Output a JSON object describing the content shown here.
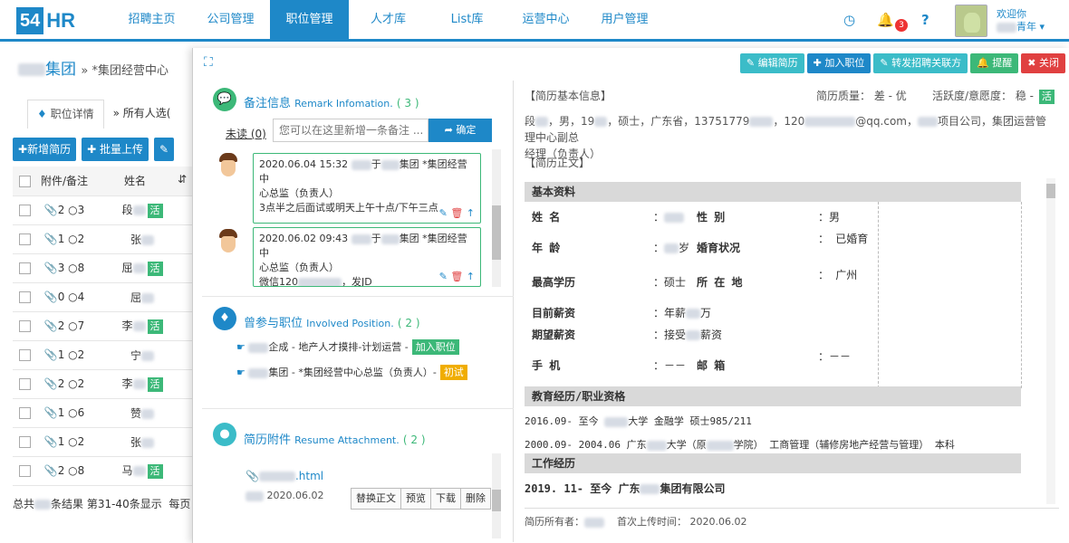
{
  "logo": {
    "num": "54",
    "text": "HR"
  },
  "nav": {
    "items": [
      {
        "label": "招聘主页"
      },
      {
        "label": "公司管理"
      },
      {
        "label": "职位管理",
        "active": true
      },
      {
        "label": "人才库"
      },
      {
        "label": "List库"
      },
      {
        "label": "运营中心"
      },
      {
        "label": "用户管理"
      }
    ],
    "notification_count": "3",
    "welcome": "欢迎你",
    "user_suffix": "青年"
  },
  "left": {
    "company_suffix": "集团",
    "breadcrumb": "» *集团经营中心",
    "tabs": [
      "职位详情",
      "所有人选("
    ],
    "buttons": [
      "新增简历",
      "批量上传"
    ],
    "table": {
      "headers": [
        "附件/备注",
        "姓名"
      ],
      "rows": [
        {
          "att": "2",
          "rem": "3",
          "name": "段",
          "huo": true
        },
        {
          "att": "1",
          "rem": "2",
          "name": "张",
          "huo": false
        },
        {
          "att": "3",
          "rem": "8",
          "name": "屈",
          "huo": true
        },
        {
          "att": "0",
          "rem": "4",
          "name": "屈",
          "huo": false
        },
        {
          "att": "2",
          "rem": "7",
          "name": "李",
          "huo": true
        },
        {
          "att": "1",
          "rem": "2",
          "name": "宁",
          "huo": false
        },
        {
          "att": "2",
          "rem": "2",
          "name": "李",
          "huo": true
        },
        {
          "att": "1",
          "rem": "6",
          "name": "赞",
          "huo": false
        },
        {
          "att": "1",
          "rem": "2",
          "name": "张",
          "huo": false
        },
        {
          "att": "2",
          "rem": "8",
          "name": "马",
          "huo": true
        }
      ],
      "huo_label": "活"
    },
    "footer": {
      "prefix": "总共",
      "suffix": "条结果  第31-40条显示",
      "more": "每页"
    }
  },
  "modal": {
    "toolbar": [
      "编辑简历",
      "加入职位",
      "转发招聘关联方",
      "提醒",
      "关闭"
    ],
    "remarks": {
      "title": "备注信息",
      "en": "Remark Infomation.",
      "count": "( 3 )",
      "undone": "未读 (0)",
      "placeholder": "您可以在这里新增一条备注 ...",
      "confirm": "确定",
      "notes": [
        {
          "time": "2020.06.04 15:32",
          "mid": "于",
          "company": "集团 *集团经营中",
          "line2": "心总监（负责人）",
          "text": "3点半之后面试或明天上午十点/下午三点"
        },
        {
          "time": "2020.06.02 09:43",
          "mid": "于",
          "company": "集团 *集团经营中",
          "line2": "心总监（负责人）",
          "text": "微信120",
          "text_tail": "，发JD"
        }
      ]
    },
    "positions": {
      "title": "曾参与职位",
      "en": "Involved Position.",
      "count": "( 2 )",
      "items": [
        {
          "text": "企成 - 地产人才摸排-计划运营 -",
          "tag": "加入职位",
          "tag_color": "#3cb878"
        },
        {
          "text": "集团 - *集团经营中心总监（负责人）-",
          "tag": "初试",
          "tag_color": "#f0ad00"
        }
      ]
    },
    "attachments": {
      "title": "简历附件",
      "en": "Resume Attachment.",
      "count": "( 2 )",
      "file": ".html",
      "date": "2020.06.02",
      "buttons": [
        "替换正文",
        "预览",
        "下载",
        "删除"
      ]
    },
    "resume": {
      "basic_header": "【简历基本信息】",
      "quality": "简历质量：  差 - 优",
      "activity": "活跃度/意愿度：  稳 -",
      "activity_tag": "活",
      "summary_1": "段",
      "summary_2": "，男，19",
      "summary_3": "，硕士，广东省，13751779",
      "summary_4": "，120",
      "summary_5": "@qq.com，",
      "summary_6": "项目公司，集团运营管理中心副总",
      "summary_7": "经理（负责人）",
      "body_header": "【简历正文】",
      "sec_basic": "基本资料",
      "fields": {
        "name_k": "姓  名",
        "name_v": "：",
        "gender_k": "性  别",
        "gender_v": "：男",
        "age_k": "年  龄",
        "age_v": "：",
        "age_unit": "岁",
        "marital_k": "婚育状况",
        "marital_v": "：  已婚育",
        "edu_k": "最高学历",
        "edu_v": "：硕士",
        "loc_k": "所 在 地",
        "loc_v": "：  广州",
        "cur_sal_k": "目前薪资",
        "cur_sal_v": "：年薪",
        "cur_sal_unit": "万",
        "exp_sal_k": "期望薪资",
        "exp_sal_v": "：接受",
        "exp_sal_unit": "薪资",
        "phone_k": "手  机",
        "phone_v": "：－－",
        "mail_k": "邮  箱",
        "mail_v": "：－－"
      },
      "sec_edu": "教育经历/职业资格",
      "edu_1": "2016.09- 至今",
      "edu_1b": "大学  金融学  硕士985/211",
      "edu_2": "2000.09- 2004.06 广东",
      "edu_2b": "大学（原",
      "edu_2c": "学院）  工商管理（辅修房地产经营与管理）  本科",
      "sec_work": "工作经历",
      "work_1": "2019. 11- 至今  广东",
      "work_1b": "集团有限公司",
      "footer_owner": "简历所有者：",
      "footer_upload": "首次上传时间：  2020.06.02"
    }
  },
  "colors": {
    "brand": "#1e88c8",
    "green": "#3cb878",
    "red": "#e04040",
    "orange": "#f0ad00"
  }
}
